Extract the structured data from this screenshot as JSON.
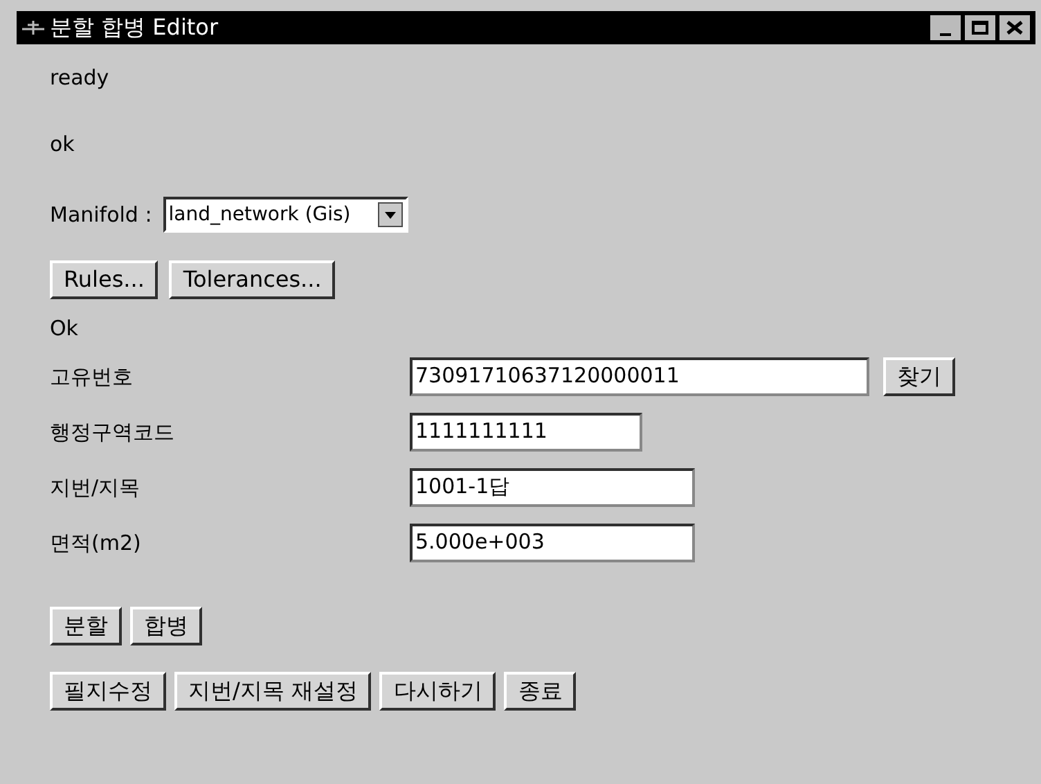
{
  "window": {
    "title": "분할 합병 Editor"
  },
  "status_lines": [
    "ready",
    "ok"
  ],
  "manifold": {
    "label": "Manifold :",
    "value": "land_network (Gis)"
  },
  "rule_buttons": [
    "Rules...",
    "Tolerances..."
  ],
  "result": "Ok",
  "fields": [
    {
      "label": "고유번호",
      "value": "73091710637120000011",
      "button": "찾기"
    },
    {
      "label": "행정구역코드",
      "value": "1111111111"
    },
    {
      "label": "지번/지목",
      "value": "1001-1답"
    },
    {
      "label": "면적(m2)",
      "value": "5.000e+003"
    }
  ],
  "edit_buttons": [
    "분할",
    "합병"
  ],
  "action_buttons": [
    "필지수정",
    "지번/지목 재설정",
    "다시하기",
    "종료"
  ]
}
